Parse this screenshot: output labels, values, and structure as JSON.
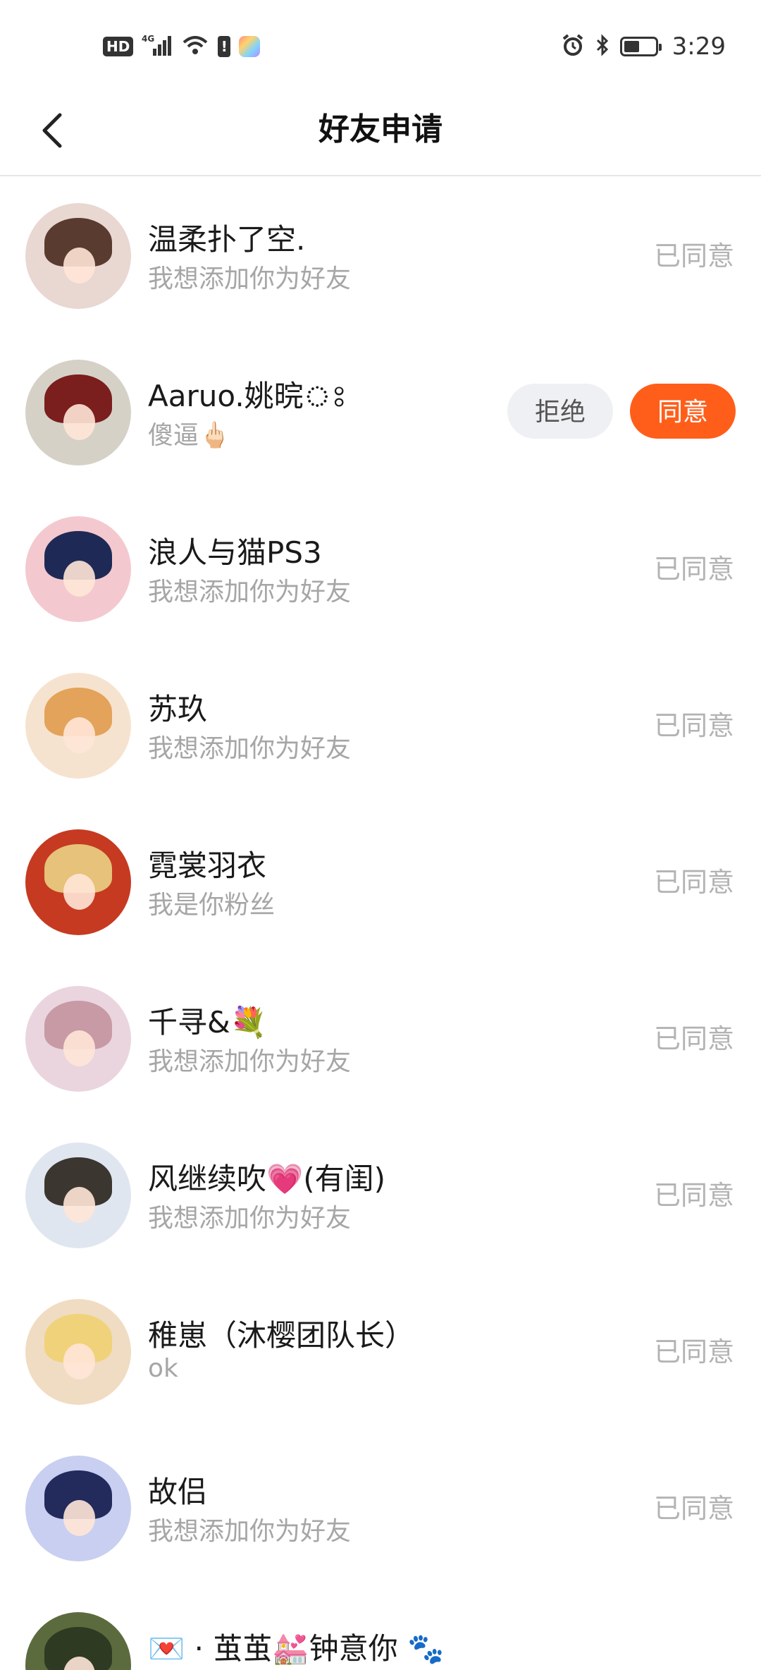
{
  "status_bar": {
    "hd": "HD",
    "network": "4G",
    "time": "3:29",
    "battery_level": 0.45
  },
  "header": {
    "back_icon": "chevron-left-icon",
    "title": "好友申请"
  },
  "requests": [
    {
      "name": "温柔扑了空.",
      "message": "我想添加你为好友",
      "status": "已同意",
      "avatar_bg": "#e9d7d2",
      "avatar_hair": "#5a3b30"
    },
    {
      "name": "Aaruo.姚晥ঃ",
      "message": "傻逼🖕🏻",
      "status": "",
      "avatar_bg": "#d6d1c7",
      "avatar_hair": "#7a1e1e"
    },
    {
      "name": "浪人与猫PS3",
      "message": "我想添加你为好友",
      "status": "已同意",
      "avatar_bg": "#f3c9cf",
      "avatar_hair": "#1e2a55"
    },
    {
      "name": "苏玖",
      "message": "我想添加你为好友",
      "status": "已同意",
      "avatar_bg": "#f6e3cf",
      "avatar_hair": "#e3a35a"
    },
    {
      "name": "霓裳羽衣",
      "message": "我是你粉丝",
      "status": "已同意",
      "avatar_bg": "#c63a21",
      "avatar_hair": "#e6c27a"
    },
    {
      "name": "千寻&💐",
      "message": "我想添加你为好友",
      "status": "已同意",
      "avatar_bg": "#ead5df",
      "avatar_hair": "#c79aa6"
    },
    {
      "name": "风继续吹💗(有闺)",
      "message": "我想添加你为好友",
      "status": "已同意",
      "avatar_bg": "#dfe6ef",
      "avatar_hair": "#3c3630"
    },
    {
      "name": "稚崽（沐樱团队长）",
      "message": "ok",
      "status": "已同意",
      "avatar_bg": "#f0dcc2",
      "avatar_hair": "#f0d27a"
    },
    {
      "name": "故侣",
      "message": "我想添加你为好友",
      "status": "已同意",
      "avatar_bg": "#c9cff0",
      "avatar_hair": "#232a5c"
    },
    {
      "name": "💌 · 茧茧💒钟意你 🐾",
      "message": "",
      "status": "",
      "avatar_bg": "#5b6b3e",
      "avatar_hair": "#2e3a22"
    }
  ],
  "actions": {
    "reject_label": "拒绝",
    "accept_label": "同意"
  }
}
